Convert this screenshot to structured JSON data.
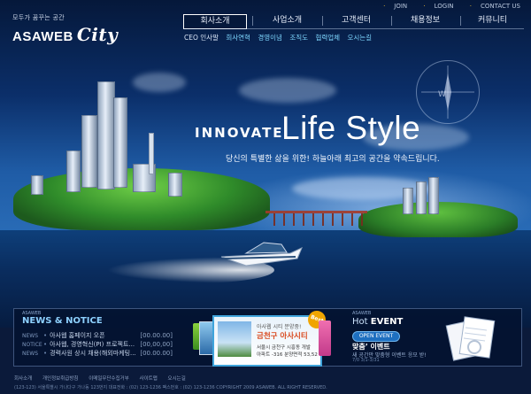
{
  "header": {
    "logo_tag": "모두가 꿈꾸는 공간",
    "logo_brand": "ASAWEB",
    "logo_city": "City",
    "util_links": [
      "JOIN",
      "LOGIN",
      "CONTACT US"
    ],
    "nav": [
      {
        "label": "회사소개",
        "active": true
      },
      {
        "label": "사업소개",
        "active": false
      },
      {
        "label": "고객센터",
        "active": false
      },
      {
        "label": "채용정보",
        "active": false
      },
      {
        "label": "커뮤니티",
        "active": false
      }
    ],
    "subnav": [
      "CEO 인사말",
      "회사연혁",
      "경영이념",
      "조직도",
      "협력업체",
      "오시는길"
    ]
  },
  "hero": {
    "innovate": "INNOVATE",
    "lifestyle": "Life Style",
    "subtitle": "당신의 특별한 삶을 위한! 하늘아래 최고의 공간을 약속드립니다."
  },
  "news": {
    "small_label": "ASAWEB",
    "title": "NEWS & NOTICE",
    "rows": [
      {
        "category": "NEWS",
        "text": "아사웹 홈페이지 오픈",
        "date": "[00.00.00]"
      },
      {
        "category": "NOTICE",
        "text": "아사웹, 경영혁신(PI) 프로젝트...",
        "date": "[00,00,00]"
      },
      {
        "category": "NEWS",
        "text": "경력사원 상시 채용(해외마케팅...",
        "date": "[00.00.00]"
      }
    ]
  },
  "promo": {
    "line1": "아사웹 시티 분양중!",
    "line2": "금천구 아사시티",
    "line3": "서울시 금천구 시흥동 개발",
    "line4": "아파트 -316 분양면적 53,52",
    "badge": "Best"
  },
  "hot_event": {
    "small_label": "ASAWEB",
    "title_prefix": "Hot",
    "title_main": "EVENT",
    "button": "OPEN EVENT",
    "line1_bold": "맞춤’ 이벤트",
    "line2": "새 공간만 맞춤형 이벤트 응모 받!",
    "line3": "7/0 3/1-3/31"
  },
  "footer": {
    "links": [
      "회사소개",
      "개인정보취급방침",
      "이메일무단수집거부",
      "사이트맵",
      "오시는길"
    ],
    "copyright": "(123-123) 서울특별시 가나다구 가나동 123번지 대표전화 : (02) 123-1236 팩스번호 : (02) 123-1236   COPYRIGHT 2009 ASAWEB. ALL RIGHT RESERVED."
  }
}
